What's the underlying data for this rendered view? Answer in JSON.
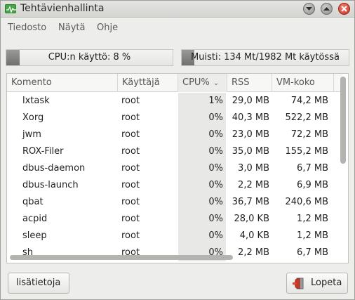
{
  "window": {
    "title": "Tehtävienhallinta"
  },
  "menu": {
    "items": [
      "Tiedosto",
      "Näytä",
      "Ohje"
    ]
  },
  "meters": {
    "cpu": {
      "label": "CPU:n käyttö: 8 %",
      "fraction": 0.08
    },
    "memory": {
      "label": "Muisti: 134 Mt/1982 Mt käytössä",
      "fraction": 0.068
    }
  },
  "table": {
    "columns": [
      "Komento",
      "Käyttäjä",
      "CPU%",
      "RSS",
      "VM-koko"
    ],
    "sorted_column": "CPU%",
    "rows": [
      {
        "command": "lxtask",
        "user": "root",
        "cpu": "1%",
        "rss": "29,0 MB",
        "vm": "74,2 MB"
      },
      {
        "command": "Xorg",
        "user": "root",
        "cpu": "0%",
        "rss": "40,3 MB",
        "vm": "522,2 MB"
      },
      {
        "command": "jwm",
        "user": "root",
        "cpu": "0%",
        "rss": "23,0 MB",
        "vm": "72,2 MB"
      },
      {
        "command": "ROX-Filer",
        "user": "root",
        "cpu": "0%",
        "rss": "35,0 MB",
        "vm": "155,2 MB"
      },
      {
        "command": "dbus-daemon",
        "user": "root",
        "cpu": "0%",
        "rss": "3,0 MB",
        "vm": "6,7 MB"
      },
      {
        "command": "dbus-launch",
        "user": "root",
        "cpu": "0%",
        "rss": "2,2 MB",
        "vm": "6,9 MB"
      },
      {
        "command": "qbat",
        "user": "root",
        "cpu": "0%",
        "rss": "36,7 MB",
        "vm": "240,6 MB"
      },
      {
        "command": "acpid",
        "user": "root",
        "cpu": "0%",
        "rss": "28,0 KB",
        "vm": "1,2 MB"
      },
      {
        "command": "sleep",
        "user": "root",
        "cpu": "0%",
        "rss": "4,0 KB",
        "vm": "1,2 MB"
      },
      {
        "command": "sh",
        "user": "root",
        "cpu": "0%",
        "rss": "2,2 MB",
        "vm": "6,7 MB"
      }
    ]
  },
  "buttons": {
    "details": "lisätietoja",
    "quit": "Lopeta"
  },
  "icons": {
    "app": "task-manager-icon",
    "minimize": "minimize-icon",
    "maximize": "maximize-icon",
    "close": "close-icon",
    "sort": "chevron-down-icon",
    "quit": "exit-door-icon"
  },
  "colors": {
    "close": "#d0412c",
    "app_icon": "#47a447",
    "meter_fill": "#7d7d7b"
  }
}
